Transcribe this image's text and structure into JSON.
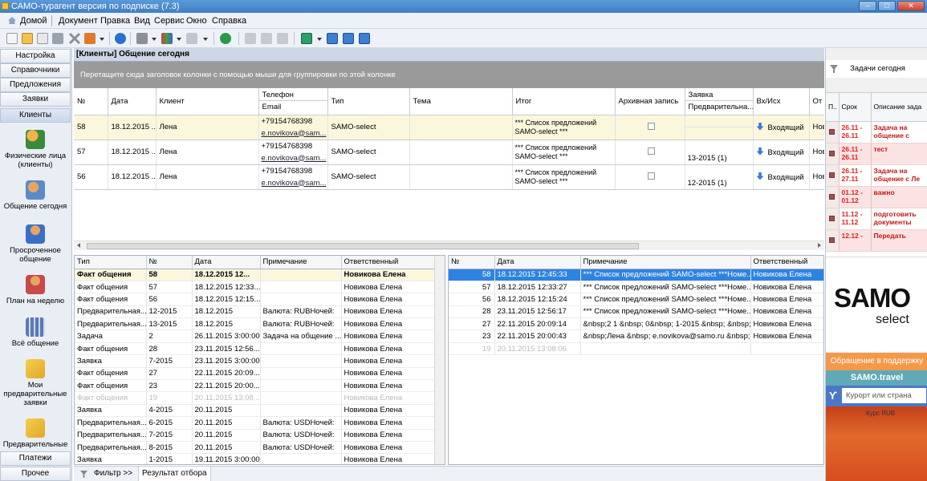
{
  "window": {
    "title": "САМО-турагент версия по подписке (7.3)"
  },
  "menu": {
    "home": "Домой",
    "items": [
      "Документ",
      "Правка",
      "Вид",
      "Сервис",
      "Окно",
      "Справка"
    ]
  },
  "sidebar": {
    "top_buttons": [
      "Настройка",
      "Справочники",
      "Предложения",
      "Заявки",
      "Клиенты"
    ],
    "items": [
      "Физические лица (клиенты)",
      "Общение сегодня",
      "Просроченное общение",
      "План на неделю",
      "Всё общение",
      "Мои предварительные заявки",
      "Предварительные"
    ],
    "bottom_buttons": [
      "Платежи",
      "Прочее"
    ]
  },
  "main": {
    "header": "[Клиенты] Общение сегодня",
    "group_hint": "Перетащите сюда заголовок колонки с помощью мыши для группировки по этой колонке"
  },
  "upper_grid": {
    "headers": {
      "num": "№",
      "date": "Дата",
      "client": "Клиент",
      "phone": "Телефон",
      "email": "Email",
      "type": "Тип",
      "topic": "Тема",
      "result": "Итог",
      "archive": "Архивная запись",
      "order": "Заявка",
      "order_sub": "Предварительна...",
      "inout": "Вх/Исх",
      "other": "От"
    },
    "rows": [
      {
        "num": "58",
        "date": "18.12.2015 ...",
        "client": "Лена",
        "phone": "+79154768398",
        "email": "e.novikova@sam...",
        "type": "SAMO-select",
        "topic": "",
        "result1": "*** Список предложений",
        "result2": "SAMO-select ***",
        "order": "",
        "inout": "Входящий",
        "other": "Нов"
      },
      {
        "num": "57",
        "date": "18.12.2015 ...",
        "client": "Лена",
        "phone": "+79154768398",
        "email": "e.novikova@sam...",
        "type": "SAMO-select",
        "topic": "",
        "result1": "*** Список предложений",
        "result2": "SAMO-select ***",
        "order": "13-2015 (1)",
        "inout": "Входящий",
        "other": "Нов"
      },
      {
        "num": "56",
        "date": "18.12.2015 ...",
        "client": "Лена",
        "phone": "+79154768398",
        "email": "e.novikova@sam...",
        "type": "SAMO-select",
        "topic": "",
        "result1": "*** Список предложений",
        "result2": "SAMO-select ***",
        "order": "12-2015 (1)",
        "inout": "Входящий",
        "other": "Нов"
      }
    ]
  },
  "left_grid": {
    "headers": [
      "Тип",
      "№",
      "Дата",
      "Примечание",
      "Ответственный"
    ],
    "rows": [
      [
        "Факт общения",
        "58",
        "18.12.2015 12...",
        "",
        "Новикова Елена"
      ],
      [
        "Факт общения",
        "57",
        "18.12.2015 12:33...",
        "",
        "Новикова Елена"
      ],
      [
        "Факт общения",
        "56",
        "18.12.2015 12:15...",
        "",
        "Новикова Елена"
      ],
      [
        "Предварительная...",
        "12-2015",
        "18.12.2015",
        "Валюта: RUBНочей:",
        "Новикова Елена"
      ],
      [
        "Предварительная...",
        "13-2015",
        "18.12.2015",
        "Валюта: RUBНочей:",
        "Новикова Елена"
      ],
      [
        "Задача",
        "2",
        "26.11.2015 3:00:00",
        "Задача на общение ...",
        "Новикова Елена"
      ],
      [
        "Факт общения",
        "28",
        "23.11.2015 12:56...",
        "",
        "Новикова Елена"
      ],
      [
        "Заявка",
        "7-2015",
        "23.11.2015 3:00:00",
        "",
        "Новикова Елена"
      ],
      [
        "Факт общения",
        "27",
        "22.11.2015 20:09...",
        "",
        "Новикова Елена"
      ],
      [
        "Факт общения",
        "23",
        "22.11.2015 20:00...",
        "",
        "Новикова Елена"
      ],
      [
        "Факт общения",
        "19",
        "20.11.2015 13:08...",
        "",
        "Новикова Елена"
      ],
      [
        "Заявка",
        "4-2015",
        "20.11.2015",
        "",
        "Новикова Елена"
      ],
      [
        "Предварительная...",
        "6-2015",
        "20.11.2015",
        "Валюта: USDНочей:",
        "Новикова Елена"
      ],
      [
        "Предварительная...",
        "7-2015",
        "20.11.2015",
        "Валюта: USDНочей:",
        "Новикова Елена"
      ],
      [
        "Предварительная...",
        "8-2015",
        "20.11.2015",
        "Валюта: USDНочей:",
        "Новикова Елена"
      ],
      [
        "Заявка",
        "1-2015",
        "19.11.2015 3:00:00",
        "",
        "Новикова Елена"
      ]
    ]
  },
  "right_grid": {
    "headers": [
      "№",
      "Дата",
      "Примечание",
      "Ответственный"
    ],
    "rows": [
      [
        "58",
        "18.12.2015 12:45:33",
        "*** Список предложений SAMO-select ***Номе...",
        "Новикова Елена"
      ],
      [
        "57",
        "18.12.2015 12:33:27",
        "*** Список предложений SAMO-select ***Номе...",
        "Новикова Елена"
      ],
      [
        "56",
        "18.12.2015 12:15:24",
        "*** Список предложений SAMO-select ***Номе...",
        "Новикова Елена"
      ],
      [
        "28",
        "23.11.2015 12:56:17",
        "*** Список предложений SAMO-select ***Номе...",
        "Новикова Елена"
      ],
      [
        "27",
        "22.11.2015 20:09:14",
        "&nbsp;2  1 &nbsp; 0&nbsp; 1-2015 &nbsp; &nbsp;",
        "Новикова Елена"
      ],
      [
        "23",
        "22.11.2015 20:00:43",
        "&nbsp;Лена  &nbsp; e.novikova@samo.ru &nbsp;",
        "Новикова Елена"
      ],
      [
        "19",
        "20.11.2015 13:08:06",
        "",
        ""
      ]
    ]
  },
  "bottom_tabs": {
    "filter": "Фильтр >>",
    "result": "Результат отбора"
  },
  "right_panel": {
    "header": "Задачи сегодня",
    "headers": [
      "П..",
      "Срок",
      "Описание зада"
    ],
    "tasks": [
      {
        "term": "26.11 - 26.11",
        "desc": "Задача на общение с"
      },
      {
        "term": "26.11 - 26.11",
        "desc": "тест"
      },
      {
        "term": "26.11 - 27.11",
        "desc": "Задача на общение с Ле"
      },
      {
        "term": "01.12 - 01.12",
        "desc": "важно"
      },
      {
        "term": "11.12 - 11.12",
        "desc": "подготовить документы"
      },
      {
        "term": "12.12 -",
        "desc": "Передать"
      }
    ],
    "logo_big": "SAMO",
    "logo_small": "select",
    "support": "Обращение в поддержку",
    "travel": "SAMO.travel",
    "search_placeholder": "Курорт или страна",
    "promo_text": "Курс RUB"
  },
  "colors": {
    "selection": "#2f83e0",
    "highlight_row": "#fcf7dc",
    "task_red": "#e02020",
    "support": "#f3994a",
    "travel": "#5fa9b8"
  }
}
